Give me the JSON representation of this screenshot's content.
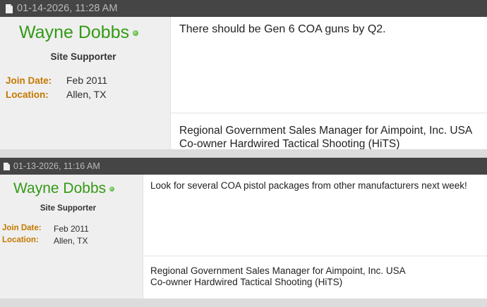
{
  "posts": [
    {
      "date": "01-14-2026, 11:28 AM",
      "username": "Wayne Dobbs",
      "user_title": "Site Supporter",
      "join_label": "Join Date:",
      "join_value": "Feb 2011",
      "location_label": "Location:",
      "location_value": "Allen, TX",
      "message": "There should be Gen 6 COA guns by Q2.",
      "signature_line1": "Regional Government Sales Manager for Aimpoint, Inc. USA",
      "signature_line2": "Co-owner Hardwired Tactical Shooting (HiTS)"
    },
    {
      "date": "01-13-2026, 11:16 AM",
      "username": "Wayne Dobbs",
      "user_title": "Site Supporter",
      "join_label": "Join Date:",
      "join_value": "Feb 2011",
      "location_label": "Location:",
      "location_value": "Allen, TX",
      "message": "Look for several COA pistol packages from other manufacturers next week!",
      "signature_line1": "Regional Government Sales Manager for Aimpoint, Inc. USA",
      "signature_line2": "Co-owner Hardwired Tactical Shooting (HiTS)"
    }
  ],
  "icons": {
    "post_icon": "document-icon",
    "online_icon": "online-status-icon"
  },
  "colors": {
    "header_bg": "#454545",
    "username": "#339a14",
    "field_label": "#c47900",
    "userinfo_bg": "#efefef"
  }
}
